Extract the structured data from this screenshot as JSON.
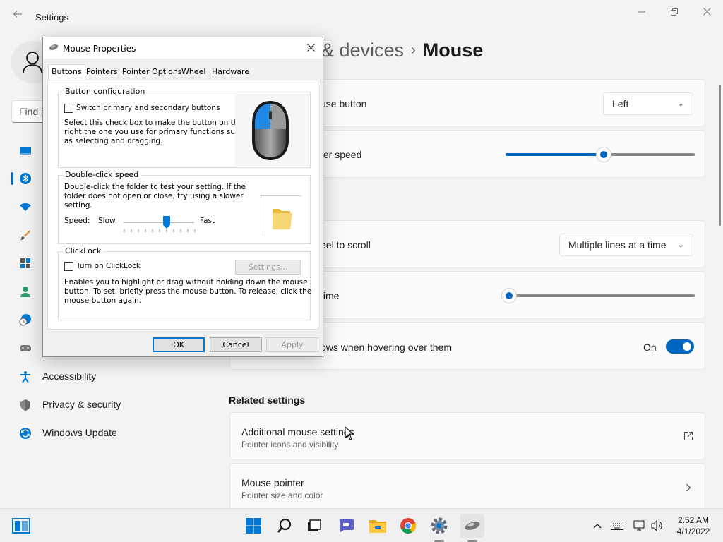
{
  "settings": {
    "title": "Settings",
    "find_placeholder": "Find a",
    "breadcrumb": {
      "parent": "& devices",
      "current": "Mouse"
    },
    "nav": [
      {
        "label": "Accessibility"
      },
      {
        "label": "Privacy & security"
      },
      {
        "label": "Windows Update"
      }
    ],
    "cards": {
      "primary_button": {
        "label": "use button",
        "value": "Left"
      },
      "pointer_speed": {
        "label": "ter speed",
        "value": 52
      },
      "wheel_scroll": {
        "label": "eel to scroll",
        "value": "Multiple lines at a time"
      },
      "lines_time": {
        "label": "time",
        "value": 3
      },
      "inactive_scroll": {
        "label": "ows when hovering over them",
        "state": "On"
      }
    },
    "related_title": "Related settings",
    "related": [
      {
        "title": "Additional mouse settings",
        "subtitle": "Pointer icons and visibility"
      },
      {
        "title": "Mouse pointer",
        "subtitle": "Pointer size and color"
      }
    ]
  },
  "dialog": {
    "title": "Mouse Properties",
    "tabs": [
      "Buttons",
      "Pointers",
      "Pointer Options",
      "Wheel",
      "Hardware"
    ],
    "button_config": {
      "title": "Button configuration",
      "checkbox": "Switch primary and secondary buttons",
      "desc": [
        "Select this check box to make the button on the",
        "right the one you use for primary functions such",
        "as selecting and dragging."
      ]
    },
    "double_click": {
      "title": "Double-click speed",
      "desc": [
        "Double-click the folder to test your setting. If the",
        "folder does not open or close, try using a slower",
        "setting."
      ],
      "speed_label": "Speed:",
      "slow": "Slow",
      "fast": "Fast",
      "value": 0.6
    },
    "clicklock": {
      "title": "ClickLock",
      "checkbox": "Turn on ClickLock",
      "settings_button": "Settings...",
      "desc": [
        "Enables you to highlight or drag without holding down the mouse",
        "button. To set, briefly press the mouse button. To release, click the",
        "mouse button again."
      ]
    },
    "buttons": {
      "ok": "OK",
      "cancel": "Cancel",
      "apply": "Apply"
    }
  },
  "taskbar": {
    "time": "2:52 AM",
    "date": "4/1/2022"
  },
  "colors": {
    "accent": "#0067c0",
    "background": "#f3f3f3"
  }
}
